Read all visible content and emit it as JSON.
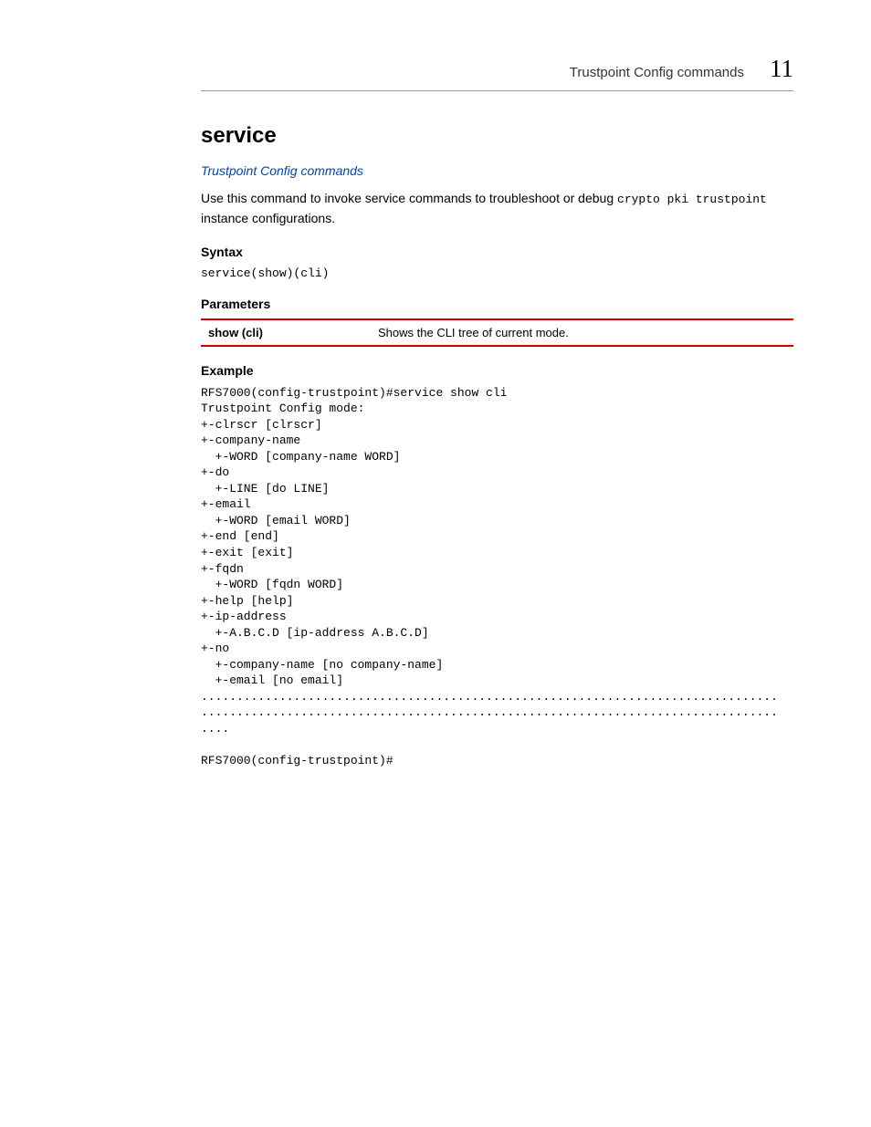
{
  "header": {
    "section": "Trustpoint Config commands",
    "chapter": "11"
  },
  "title": "service",
  "link": "Trustpoint Config commands",
  "intro_before": "Use this command to invoke service commands to troubleshoot or debug ",
  "intro_code": "crypto pki trustpoint",
  "intro_after": " instance configurations.",
  "syntax": {
    "heading": "Syntax",
    "text": "service(show)(cli)"
  },
  "parameters": {
    "heading": "Parameters",
    "rows": [
      {
        "name": "show (cli)",
        "desc": "Shows the CLI tree of current mode."
      }
    ]
  },
  "example": {
    "heading": "Example",
    "text": "RFS7000(config-trustpoint)#service show cli\nTrustpoint Config mode:\n+-clrscr [clrscr]\n+-company-name\n  +-WORD [company-name WORD]\n+-do\n  +-LINE [do LINE]\n+-email\n  +-WORD [email WORD]\n+-end [end]\n+-exit [exit]\n+-fqdn\n  +-WORD [fqdn WORD]\n+-help [help]\n+-ip-address\n  +-A.B.C.D [ip-address A.B.C.D]\n+-no\n  +-company-name [no company-name]\n  +-email [no email]\n.................................................................................\n.................................................................................\n....\n\nRFS7000(config-trustpoint)#"
  }
}
